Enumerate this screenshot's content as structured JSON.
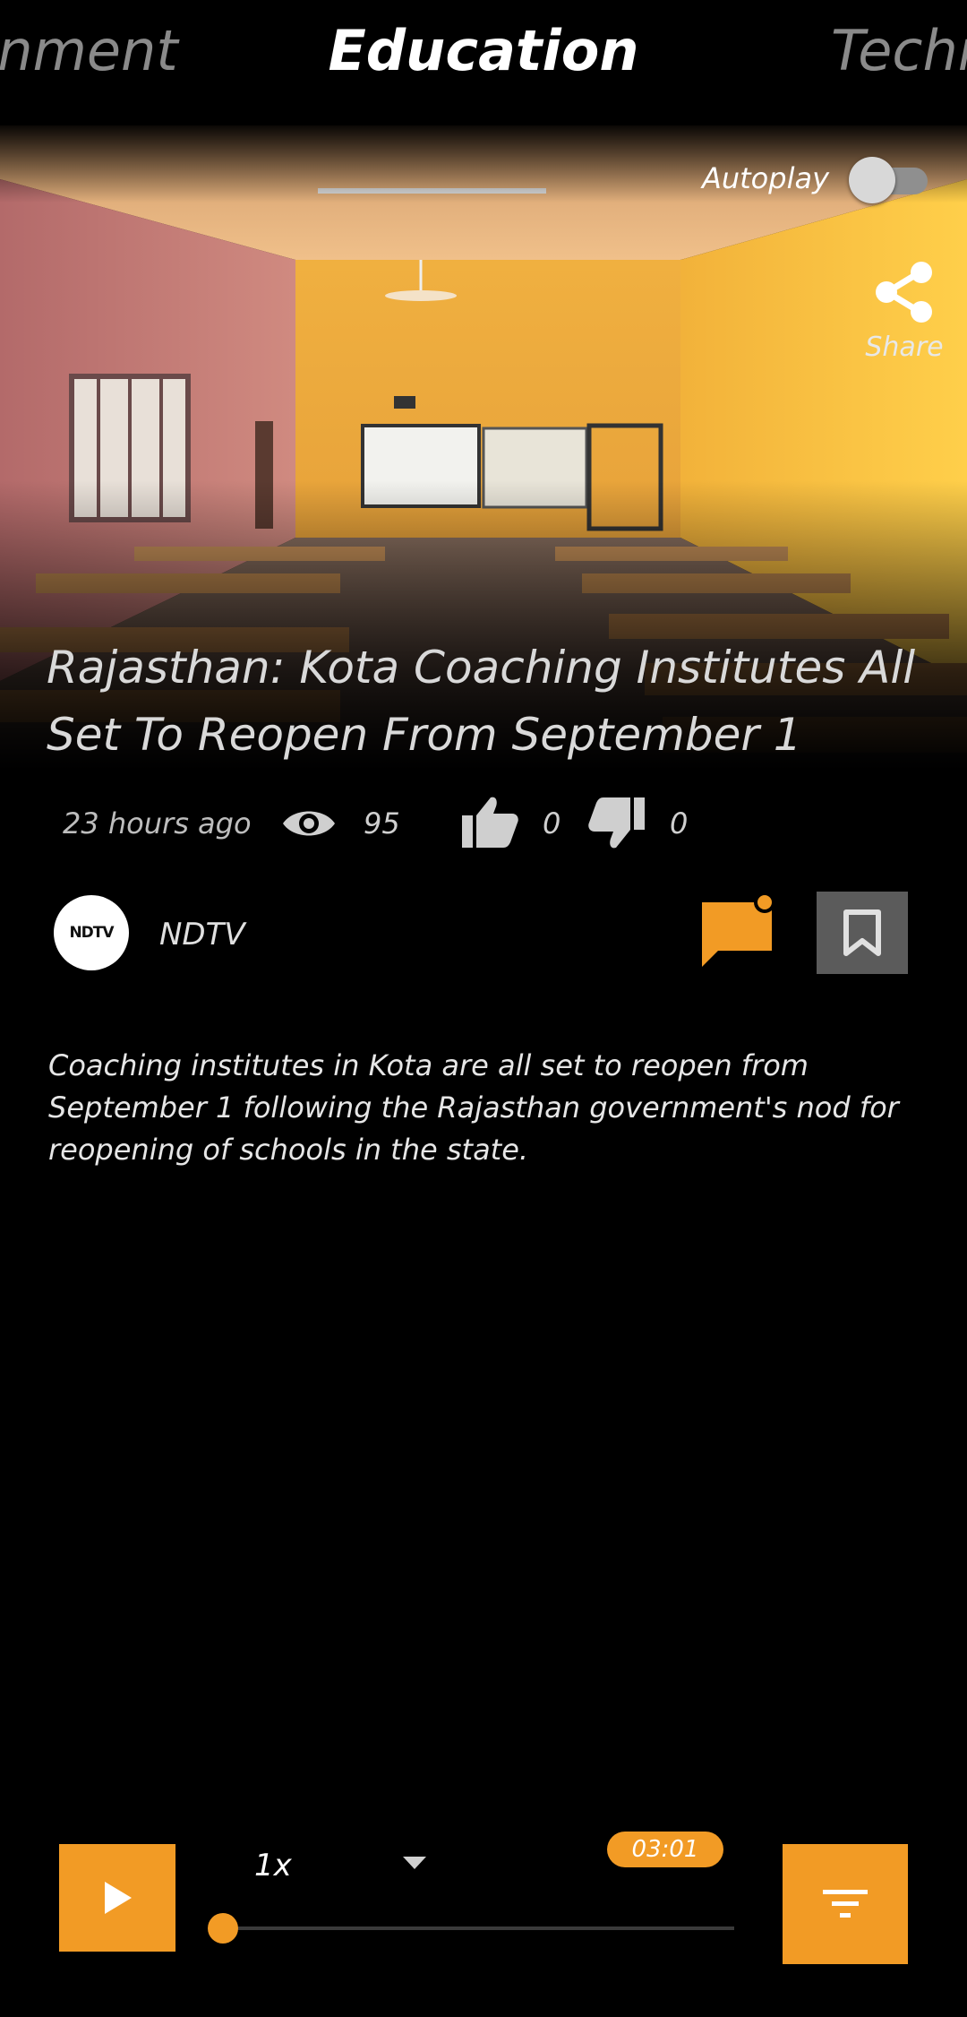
{
  "tabs": {
    "left": "inment",
    "active": "Education",
    "right": "Techr"
  },
  "player_top": {
    "autoplay_label": "Autoplay",
    "autoplay_on": false,
    "share_label": "Share"
  },
  "article": {
    "title": "Rajasthan: Kota Coaching Institutes All Set To Reopen From September 1",
    "time_ago": "23 hours ago",
    "views": "95",
    "likes": "0",
    "dislikes": "0",
    "source_logo_text": "NDTV",
    "source_name": "NDTV",
    "summary": "Coaching institutes in Kota are all set to reopen from September 1 following the Rajasthan government's nod for reopening of schools in the state."
  },
  "audio": {
    "speed": "1x",
    "duration": "03:01",
    "progress": 0
  },
  "colors": {
    "accent": "#f29b25",
    "background": "#000000",
    "bookmark_bg": "#5b5b5b"
  },
  "icons": [
    "eye-icon",
    "thumbs-up-icon",
    "thumbs-down-icon",
    "share-icon",
    "comment-icon",
    "bookmark-icon",
    "play-icon",
    "chevron-down-icon",
    "filter-icon"
  ]
}
